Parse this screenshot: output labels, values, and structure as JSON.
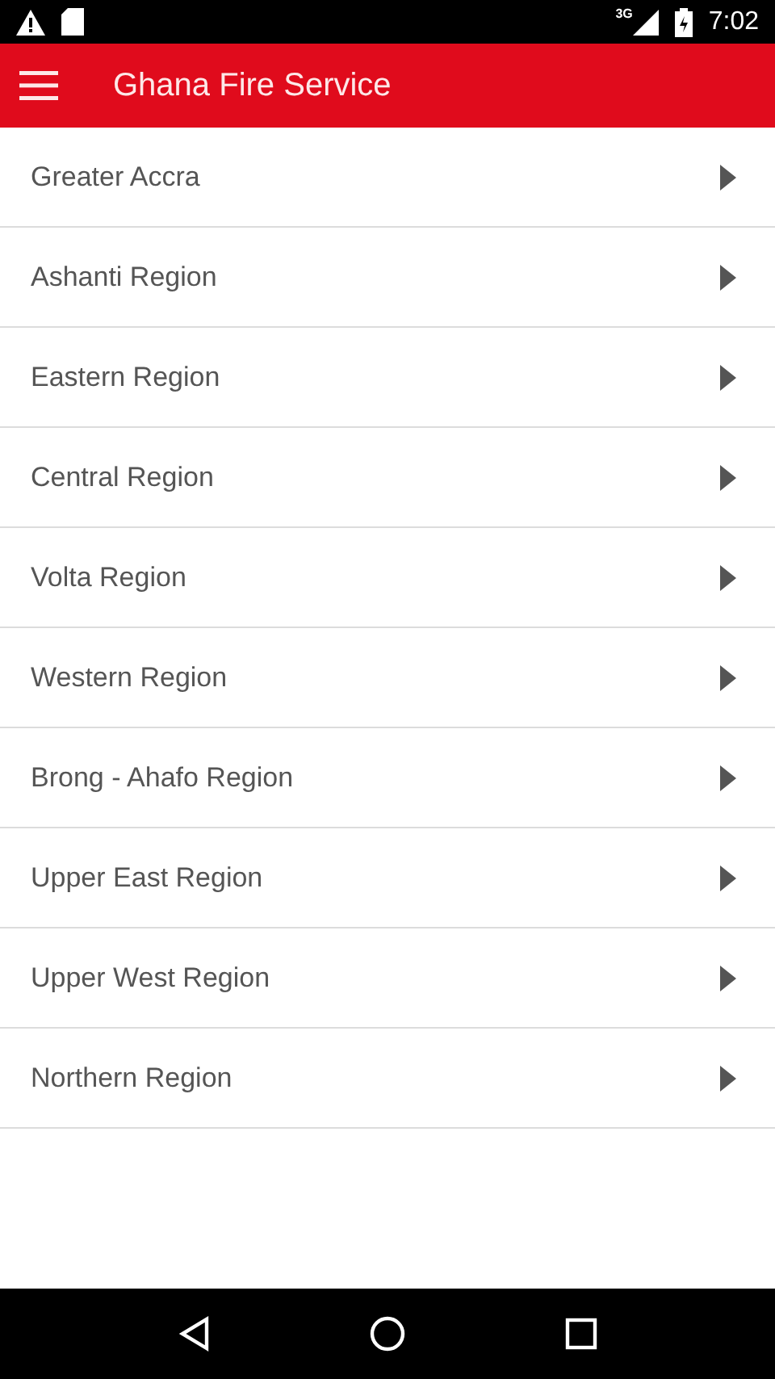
{
  "status_bar": {
    "network": "3G",
    "time": "7:02"
  },
  "app_bar": {
    "title": "Ghana Fire Service"
  },
  "regions": [
    {
      "label": "Greater Accra"
    },
    {
      "label": "Ashanti Region"
    },
    {
      "label": "Eastern Region"
    },
    {
      "label": "Central Region"
    },
    {
      "label": "Volta Region"
    },
    {
      "label": "Western Region"
    },
    {
      "label": "Brong - Ahafo Region"
    },
    {
      "label": "Upper East Region"
    },
    {
      "label": "Upper West Region"
    },
    {
      "label": "Northern Region"
    }
  ]
}
